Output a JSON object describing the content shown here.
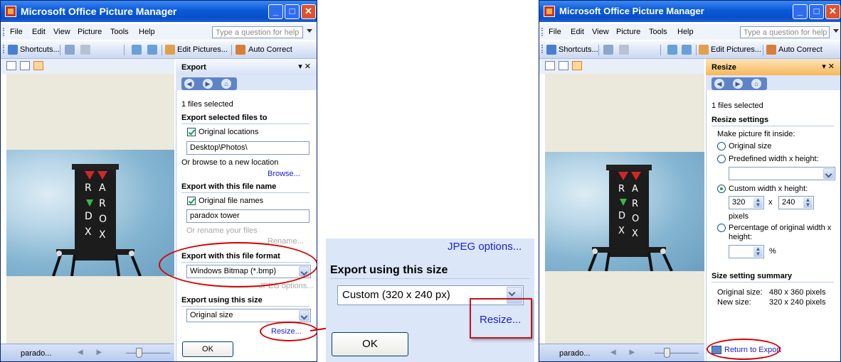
{
  "app": {
    "title": "Microsoft Office Picture Manager"
  },
  "menu": {
    "file": "File",
    "edit": "Edit",
    "view": "View",
    "picture": "Picture",
    "tools": "Tools",
    "help": "Help",
    "help_placeholder": "Type a question for help"
  },
  "toolbar": {
    "shortcuts": "Shortcuts...",
    "edit_pictures": "Edit Pictures...",
    "auto_correct": "Auto Correct"
  },
  "status": {
    "filename": "parado..."
  },
  "export_pane": {
    "title": "Export",
    "files_selected": "1 files selected",
    "export_to_title": "Export selected files to",
    "original_locations": "Original locations",
    "location_value": "Desktop\\Photos\\",
    "browse_hint": "Or browse to a new location",
    "browse_link": "Browse...",
    "file_name_title": "Export with this file name",
    "original_file_names": "Original file names",
    "file_name_value": "paradox tower",
    "rename_hint": "Or rename your files",
    "rename_link": "Rename...",
    "format_title": "Export with this file format",
    "format_value": "Windows Bitmap (*.bmp)",
    "jpeg_options": "JPEG options...",
    "size_title": "Export using this size",
    "size_value": "Original size",
    "resize_link": "Resize...",
    "ok": "OK"
  },
  "zoom": {
    "jpeg_options": "JPEG options...",
    "size_title": "Export using this size",
    "size_value": "Custom (320 x 240 px)",
    "resize_link": "Resize...",
    "ok": "OK"
  },
  "resize_pane": {
    "title": "Resize",
    "files_selected": "1 files selected",
    "settings_title": "Resize settings",
    "fit_inside": "Make picture fit inside:",
    "original_size": "Original size",
    "predefined": "Predefined width x height:",
    "custom": "Custom width x height:",
    "width": "320",
    "height": "240",
    "x": "x",
    "pixels": "pixels",
    "percentage": "Percentage of original width x height:",
    "percent_sign": "%",
    "summary_title": "Size setting summary",
    "original_size_label": "Original size:",
    "original_size_value": "480 x 360 pixels",
    "new_size_label": "New size:",
    "new_size_value": "320 x 240 pixels",
    "return_link": "Return to Export"
  },
  "colors": {
    "title_blue": "#0a5ad8",
    "link_blue": "#2020d0",
    "annotation_red": "#d40000",
    "pane_blue": "#dbe6f8",
    "resize_header": "#f8b75a"
  }
}
